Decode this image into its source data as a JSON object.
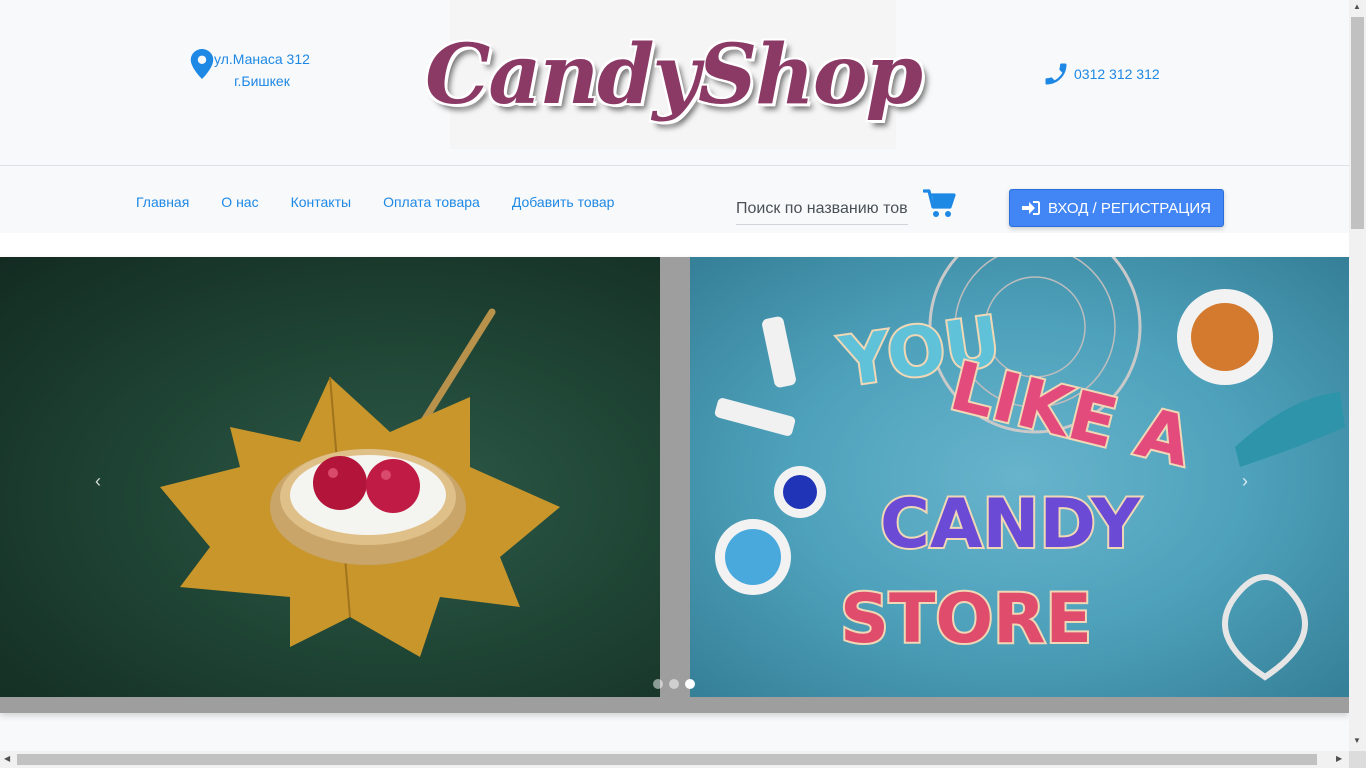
{
  "header": {
    "address_line1": "ул.Манаса 312",
    "address_line2": "г.Бишкек",
    "logo_text": "CandyShop",
    "phone": "0312 312 312"
  },
  "nav": {
    "items": [
      {
        "label": "Главная"
      },
      {
        "label": "О нас"
      },
      {
        "label": "Контакты"
      },
      {
        "label": "Оплата товара"
      },
      {
        "label": "Добавить товар"
      }
    ],
    "search_placeholder": "Поиск по названию товара",
    "login_label": "ВХОД / РЕГИСТРАЦИЯ"
  },
  "carousel": {
    "prev_symbol": "‹",
    "next_symbol": "›",
    "slide_count": 3,
    "active_index": 2,
    "right_slide_text": [
      "YOU",
      "LIKE A",
      "CANDY",
      "STORE"
    ]
  },
  "colors": {
    "link": "#1e88e5",
    "button": "#4285f4",
    "logo": "#8b3a66"
  },
  "icons": [
    "map-marker-icon",
    "phone-icon",
    "cart-icon",
    "sign-in-icon"
  ]
}
